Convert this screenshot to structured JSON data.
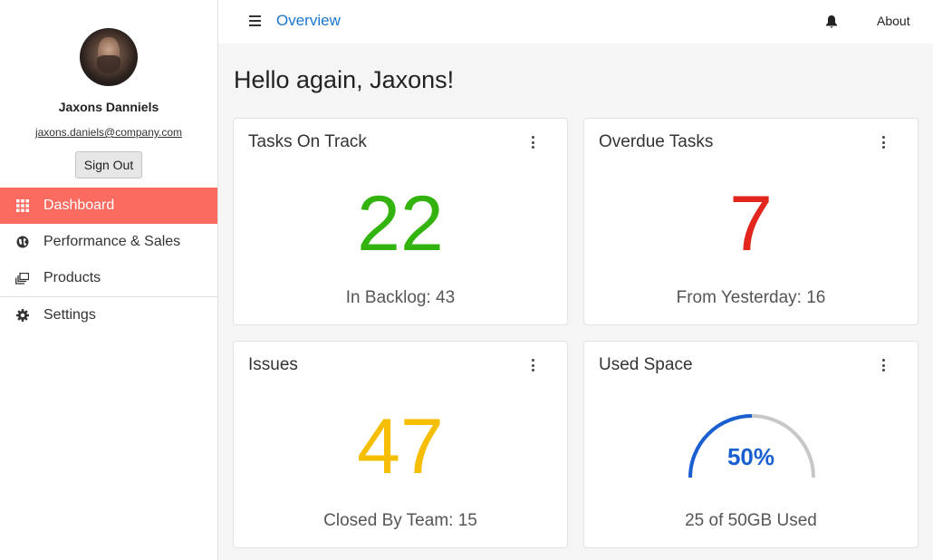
{
  "user": {
    "name": "Jaxons Danniels",
    "email": "jaxons.daniels@company.com",
    "sign_out_label": "Sign Out"
  },
  "sidebar": {
    "items": [
      {
        "label": "Dashboard",
        "icon": "grid-icon",
        "active": true
      },
      {
        "label": "Performance & Sales",
        "icon": "globe-icon"
      },
      {
        "label": "Products",
        "icon": "layers-icon"
      },
      {
        "label": "Settings",
        "icon": "gear-icon"
      }
    ]
  },
  "topbar": {
    "title": "Overview",
    "about_label": "About"
  },
  "greeting": "Hello again, Jaxons!",
  "cards": [
    {
      "title": "Tasks On Track",
      "value": "22",
      "subtitle": "In Backlog: 43",
      "color": "#33b30d"
    },
    {
      "title": "Overdue Tasks",
      "value": "7",
      "subtitle": "From Yesterday: 16",
      "color": "#e3261d"
    },
    {
      "title": "Issues",
      "value": "47",
      "subtitle": "Closed By Team: 15",
      "color": "#f5be00"
    },
    {
      "title": "Used Space",
      "value": "50%",
      "subtitle": "25 of 50GB Used",
      "color": "#1a5fd1",
      "gauge_fraction": 0.5
    }
  ],
  "colors": {
    "accent": "#fb6b5f",
    "link": "#1976d2",
    "gauge_track": "#c7c7c7"
  }
}
